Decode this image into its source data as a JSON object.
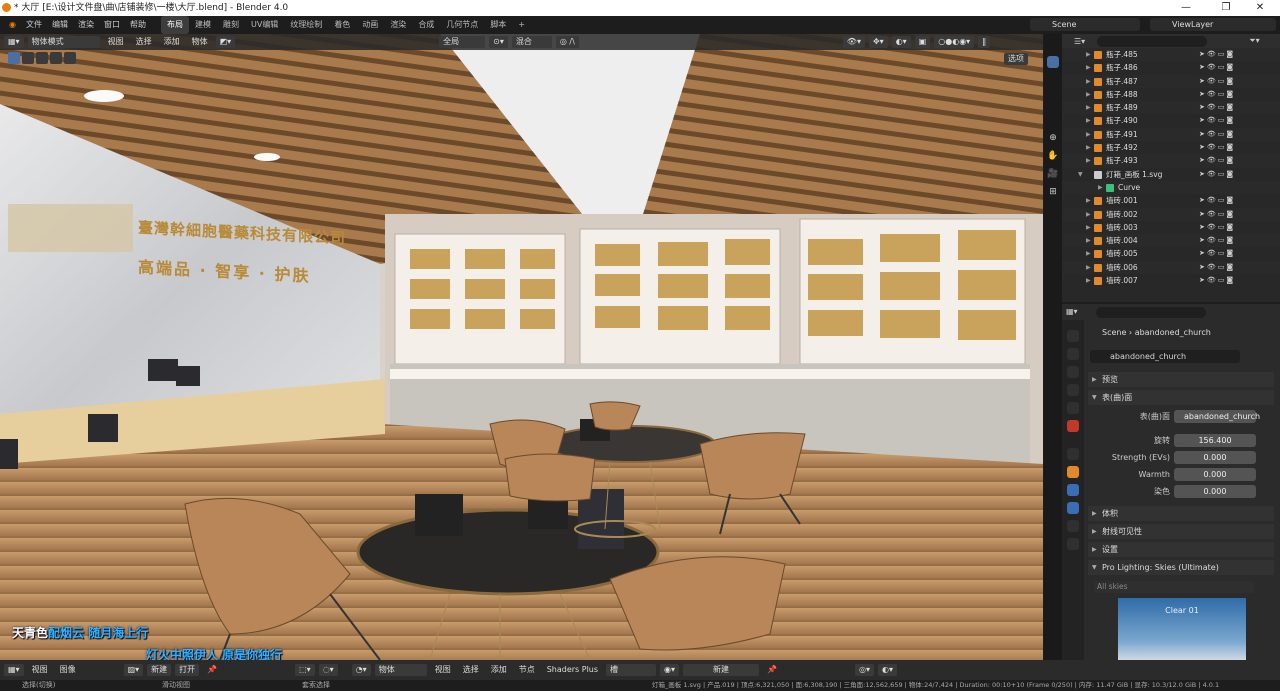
{
  "titlebar": {
    "title": "* 大厅 [E:\\设计文件盘\\曲\\店铺装修\\一楼\\大厅.blend] - Blender 4.0",
    "min": "—",
    "max": "❐",
    "close": "✕"
  },
  "menu": [
    "文件",
    "编辑",
    "渲染",
    "窗口",
    "帮助"
  ],
  "workspaces": [
    "布局",
    "建模",
    "雕刻",
    "UV编辑",
    "纹理绘制",
    "着色",
    "动画",
    "渲染",
    "合成",
    "几何节点",
    "脚本",
    "+"
  ],
  "scene": {
    "label": "Scene",
    "viewlayer": "ViewLayer"
  },
  "viewport": {
    "mode": "物体模式",
    "menus": [
      "视图",
      "选择",
      "添加",
      "物体"
    ],
    "transform": "全局",
    "blend": "混合",
    "options": "选项",
    "wall_text_line1": "臺灣幹細胞醫藥科技有限公司",
    "wall_text_line2": "高端品 · 智享 · 护肤",
    "sub1_a": "天青色",
    "sub1_b": "配烟云  随月海上行",
    "sub2_a": "灯火中照伊人  原是你独行"
  },
  "outliner": {
    "search_placeholder": "",
    "rows": [
      "瓶子.485",
      "瓶子.486",
      "瓶子.487",
      "瓶子.488",
      "瓶子.489",
      "瓶子.490",
      "瓶子.491",
      "瓶子.492",
      "瓶子.493",
      "灯箱_画板 1.svg",
      "Curve",
      "墙砖.001",
      "墙砖.002",
      "墙砖.003",
      "墙砖.004",
      "墙砖.005",
      "墙砖.006",
      "墙砖.007"
    ]
  },
  "properties": {
    "breadcrumb_scene": "Scene",
    "breadcrumb_world": "abandoned_church",
    "world_name": "abandoned_church",
    "preview": "预览",
    "surface": "表(曲)面",
    "surface_label": "表(曲)面",
    "surface_value": "abandoned_church",
    "rotation_label": "旋转",
    "rotation_value": "156.400",
    "strength_label": "Strength (EVs)",
    "strength_value": "0.000",
    "warmth_label": "Warmth",
    "warmth_value": "0.000",
    "tint_label": "染色",
    "tint_value": "0.000",
    "volume": "体积",
    "ray_vis": "射线可见性",
    "settings": "设置",
    "pro_lighting": "Pro Lighting: Skies (Ultimate)",
    "all_skies": "All skies",
    "thumb_label": "Clear 01"
  },
  "bottom": {
    "view": "视图",
    "image": "图像",
    "new": "新建",
    "open": "打开",
    "object": "物体",
    "view2": "视图",
    "select": "选择",
    "add": "添加",
    "node": "节点",
    "shaders_plus": "Shaders Plus",
    "slot": "槽",
    "new2": "新建"
  },
  "status": {
    "select": "选择(切换)",
    "pan": "滑动视图",
    "context": "套索选择",
    "stats": "灯箱_画板 1.svg | 产品.019 | 顶点:6,321,050 | 面:6,308,190 | 三角面:12,562,659 | 物体:24/7,424 | Duration: 00:10+10 (Frame 0/250) | 内存: 11.47 GiB | 显存: 10.3/12.0 GiB | 4.0.1"
  },
  "colors": {
    "accent": "#4a6fa5",
    "orange": "#e08a2c",
    "subtitle": "#2fb5ff"
  }
}
